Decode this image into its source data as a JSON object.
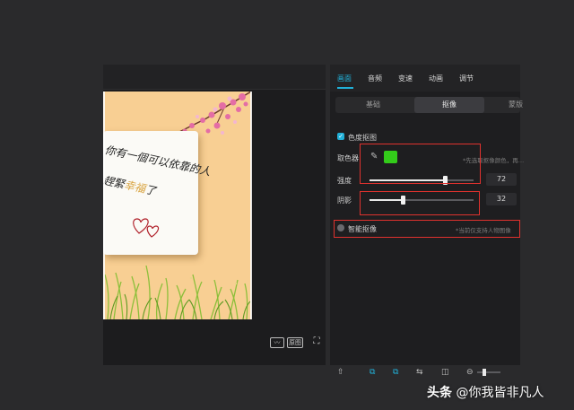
{
  "tabs": [
    "画面",
    "音频",
    "变速",
    "动画",
    "调节"
  ],
  "subtabs": [
    "基础",
    "抠像",
    "蒙版"
  ],
  "chroma_key": {
    "label": "色度抠图",
    "checked": true,
    "picker_label": "取色器",
    "picker_color": "#33cc1a",
    "picker_hint": "*先选取抠像颜色，再…",
    "strength_label": "强度",
    "strength_value": "72",
    "shadow_label": "阴影",
    "shadow_value": "32"
  },
  "smart_cutout": {
    "label": "智能抠像",
    "hint": "*当前仅支持人物图像"
  },
  "preview": {
    "card_line1": "你有一個可以依靠的人",
    "card_line2_a": "趕緊",
    "card_line2_b": "幸福",
    "card_line2_c": "了",
    "wave_btn": "〰",
    "original_btn": "原图",
    "fullscreen_icon": "⛶"
  },
  "timeline_icons": [
    "⇧",
    "⧉",
    "⧉",
    "⇆",
    "◫",
    "⊖"
  ],
  "watermark": {
    "brand": "头条",
    "author": "@你我皆非凡人"
  },
  "colors": {
    "accent": "#21b0d8",
    "annotation": "#e0322e",
    "canvas_bg": "#f8cf93"
  }
}
